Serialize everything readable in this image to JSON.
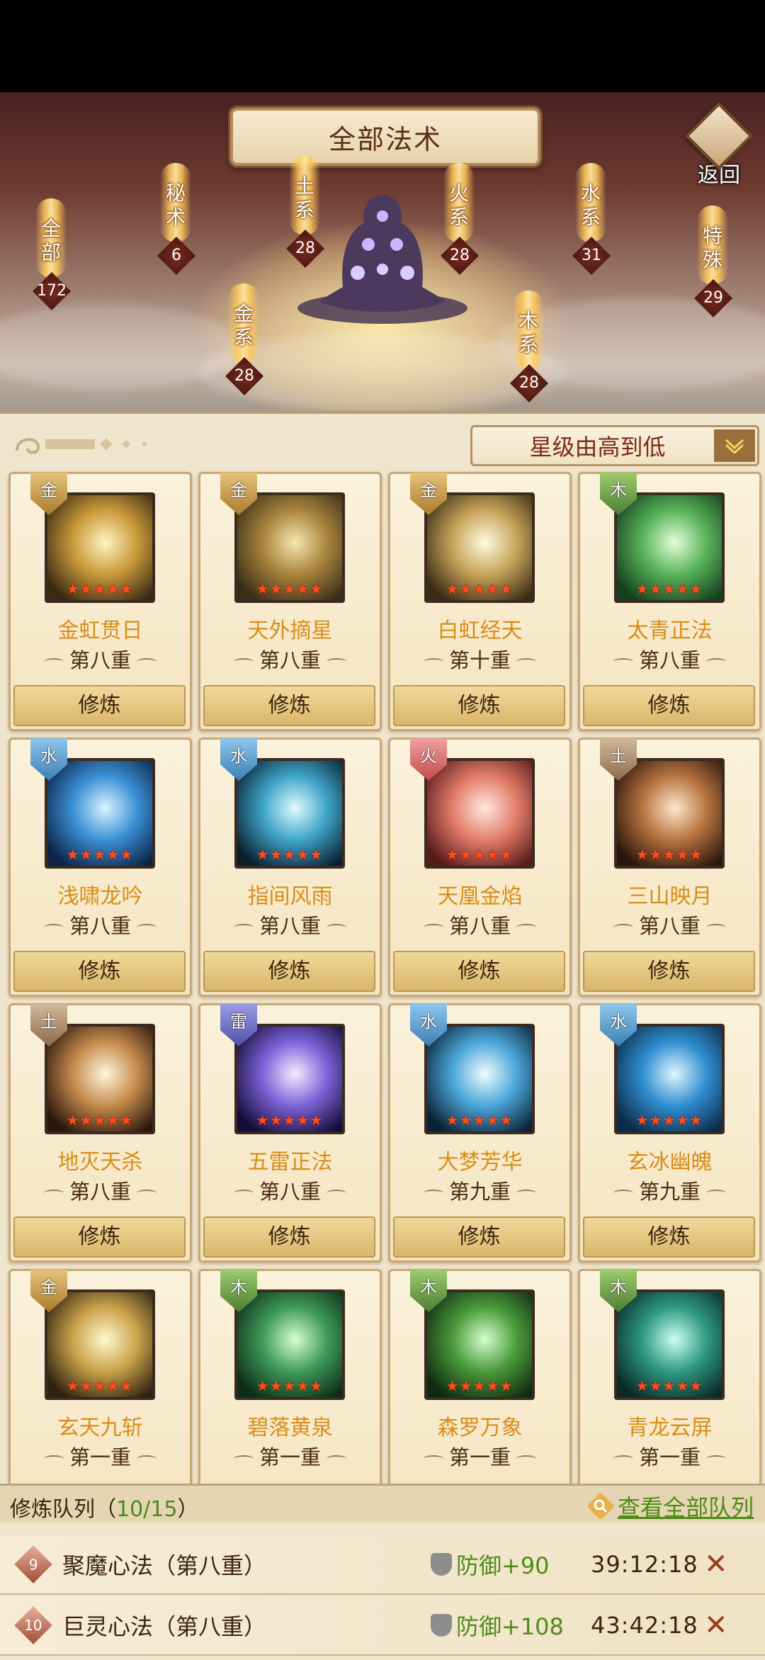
{
  "header": {
    "title": "全部法术",
    "back_label": "返回"
  },
  "schools": [
    {
      "name": "全部",
      "count": "172"
    },
    {
      "name": "秘术",
      "count": "6"
    },
    {
      "name": "土系",
      "count": "28"
    },
    {
      "name": "金系",
      "count": "28"
    },
    {
      "name": "火系",
      "count": "28"
    },
    {
      "name": "木系",
      "count": "28"
    },
    {
      "name": "水系",
      "count": "31"
    },
    {
      "name": "特殊",
      "count": "29"
    }
  ],
  "sort": {
    "label": "星级由高到低"
  },
  "cards": [
    {
      "element": "金",
      "type": "gold",
      "name": "金虹贯日",
      "level": "第八重",
      "stars": "★★★★★",
      "action": "修炼",
      "art": [
        "#fff4c2",
        "#c99a3a",
        "#3a2a14"
      ]
    },
    {
      "element": "金",
      "type": "gold",
      "name": "天外摘星",
      "level": "第八重",
      "stars": "★★★★★",
      "action": "修炼",
      "art": [
        "#f7e6b0",
        "#a8843c",
        "#3a2e18"
      ]
    },
    {
      "element": "金",
      "type": "gold",
      "name": "白虹经天",
      "level": "第十重",
      "stars": "★★★★★",
      "action": "修炼",
      "art": [
        "#fffbe0",
        "#c7a45a",
        "#3a2c14"
      ]
    },
    {
      "element": "木",
      "type": "wood",
      "name": "太青正法",
      "level": "第八重",
      "stars": "★★★★★",
      "action": "修炼",
      "art": [
        "#e6ffd8",
        "#58b35a",
        "#14401e"
      ]
    },
    {
      "element": "水",
      "type": "water",
      "name": "浅啸龙吟",
      "level": "第八重",
      "stars": "★★★★★",
      "action": "修炼",
      "art": [
        "#d8f4ff",
        "#3b8fd6",
        "#0c2446"
      ]
    },
    {
      "element": "水",
      "type": "water",
      "name": "指间风雨",
      "level": "第八重",
      "stars": "★★★★★",
      "action": "修炼",
      "art": [
        "#e2fbff",
        "#3ea3c8",
        "#0a1f2e"
      ]
    },
    {
      "element": "火",
      "type": "fire",
      "name": "天凰金焰",
      "level": "第八重",
      "stars": "★★★★★",
      "action": "修炼",
      "art": [
        "#ffe9e0",
        "#e27d6a",
        "#5a1a1a"
      ]
    },
    {
      "element": "土",
      "type": "earth",
      "name": "三山映月",
      "level": "第八重",
      "stars": "★★★★★",
      "action": "修炼",
      "art": [
        "#ffe7cc",
        "#b7733f",
        "#2a160c"
      ]
    },
    {
      "element": "土",
      "type": "earth",
      "name": "地灭天杀",
      "level": "第八重",
      "stars": "★★★★★",
      "action": "修炼",
      "art": [
        "#fff5dc",
        "#c58b4c",
        "#2a160c"
      ]
    },
    {
      "element": "雷",
      "type": "thunder",
      "name": "五雷正法",
      "level": "第八重",
      "stars": "★★★★★",
      "action": "修炼",
      "art": [
        "#f3ecff",
        "#7a63d8",
        "#140c36"
      ]
    },
    {
      "element": "水",
      "type": "water",
      "name": "大梦芳华",
      "level": "第九重",
      "stars": "★★★★★",
      "action": "修炼",
      "art": [
        "#f0fcff",
        "#4aa6d8",
        "#0a2236"
      ]
    },
    {
      "element": "水",
      "type": "water",
      "name": "玄冰幽魄",
      "level": "第九重",
      "stars": "★★★★★",
      "action": "修炼",
      "art": [
        "#e0f6ff",
        "#2f8ed0",
        "#0c2a4a"
      ]
    },
    {
      "element": "金",
      "type": "gold",
      "name": "玄天九斩",
      "level": "第一重",
      "stars": "★★★★★",
      "action": "",
      "art": [
        "#fff8d0",
        "#caa24a",
        "#2e2210"
      ]
    },
    {
      "element": "木",
      "type": "wood",
      "name": "碧落黄泉",
      "level": "第一重",
      "stars": "★★★★★",
      "action": "",
      "art": [
        "#d8ffd4",
        "#3f9a5a",
        "#0c2e16"
      ]
    },
    {
      "element": "木",
      "type": "wood",
      "name": "森罗万象",
      "level": "第一重",
      "stars": "★★★★★",
      "action": "",
      "art": [
        "#d4ffcc",
        "#4a9a3a",
        "#0f2a10"
      ]
    },
    {
      "element": "木",
      "type": "wood",
      "name": "青龙云屏",
      "level": "第一重",
      "stars": "★★★★★",
      "action": "",
      "art": [
        "#ccfff0",
        "#2e9a80",
        "#0a2a26"
      ]
    }
  ],
  "queue": {
    "title": "修炼队列（",
    "count": "10/15",
    "title_end": "）",
    "view_all": "查看全部队列",
    "rows": [
      {
        "num": "9",
        "name": "聚魔心法（第八重）",
        "bonus": "防御+90",
        "time": "39:12:18"
      },
      {
        "num": "10",
        "name": "巨灵心法（第八重）",
        "bonus": "防御+108",
        "time": "43:42:18"
      }
    ]
  },
  "colors": {
    "accent_gold": "#d88d18",
    "green_text": "#4f8c16",
    "panel_bg": "#efe4cc"
  }
}
